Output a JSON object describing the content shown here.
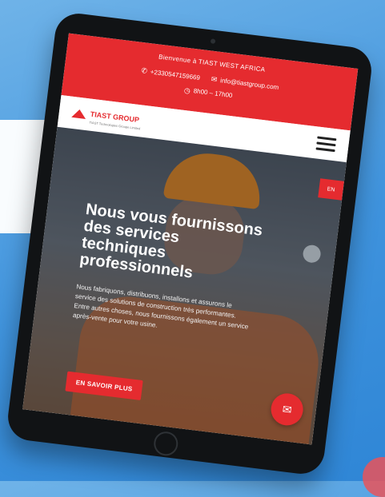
{
  "topbar": {
    "welcome": "Bienvenue à TIAST WEST AFRICA",
    "phone": "+2330547159669",
    "email": "info@tiastgroup.com",
    "hours": "8h00 – 17h00"
  },
  "header": {
    "logo_text": "TIAST GROUP",
    "logo_sub": "TIAST Technologies Groupe Limited"
  },
  "hero": {
    "title": "Nous vous fournissons des services techniques professionnels",
    "description": "Nous fabriquons, distribuons, installons et assurons le service des solutions de construction très performantes. Entre autres choses, nous fournissons également un service après-vente pour votre usine.",
    "cta": "EN SAVOIR PLUS",
    "flag_label": "EN"
  },
  "icons": {
    "phone": "phone-icon",
    "email": "mail-icon",
    "clock": "clock-icon",
    "menu": "hamburger-menu-icon",
    "chat": "chat-icon"
  },
  "colors": {
    "accent": "#e52b2f",
    "background": "#3f93dd"
  }
}
